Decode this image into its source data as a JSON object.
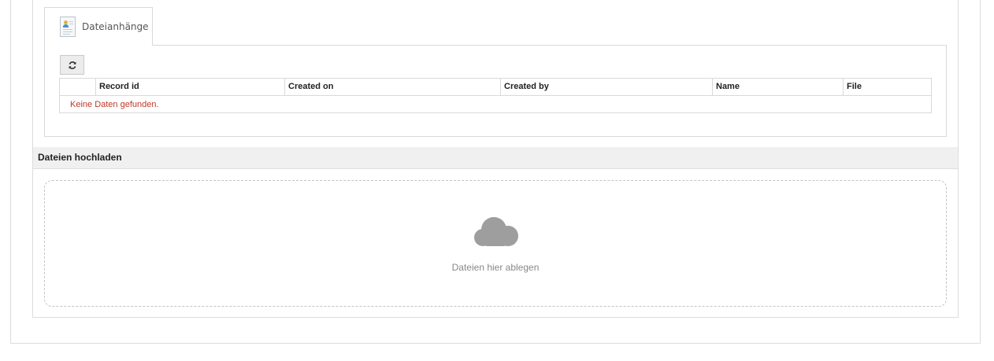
{
  "tabs": [
    {
      "label": "Dateianhänge",
      "icon": "contact-card-icon",
      "active": true
    }
  ],
  "toolbar": {
    "refresh_icon": "refresh-icon"
  },
  "grid": {
    "columns": [
      "",
      "Record id",
      "Created on",
      "Created by",
      "Name",
      "File"
    ],
    "empty_message": "Keine Daten gefunden."
  },
  "upload_section": {
    "title": "Dateien hochladen",
    "dropzone_icon": "cloud-icon",
    "dropzone_text": "Dateien hier ablegen"
  },
  "colors": {
    "empty_message": "#c0392b",
    "cloud": "#9e9e9e"
  }
}
